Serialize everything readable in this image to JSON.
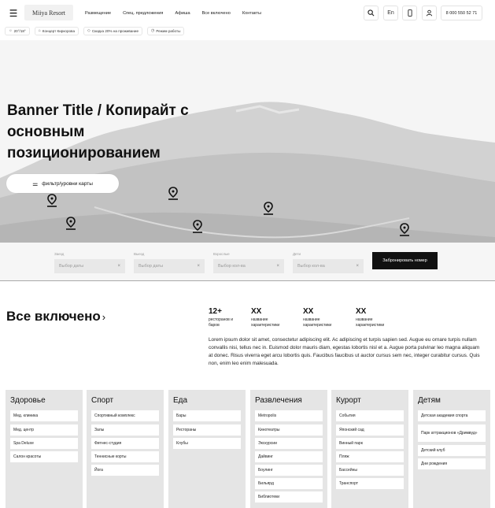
{
  "header": {
    "logo": "Miiya Resort",
    "nav": [
      "Размещение",
      "Спец. предложения",
      "Афиша",
      "Все включено",
      "Контакты"
    ],
    "lang": "En",
    "phone": "8 000 550 52 71"
  },
  "chips": [
    {
      "icon": "☼",
      "label": "20°/18°"
    },
    {
      "icon": "⌂",
      "label": "Концерт Киркорова"
    },
    {
      "icon": "◇",
      "label": "Скидка 20% на проживание"
    },
    {
      "icon": "◷",
      "label": "Режим работы"
    }
  ],
  "hero": {
    "title": "Banner Title / Копирайт с основным позиционированием",
    "filter_label": "фильтр/уровни карты"
  },
  "booking": {
    "fields": [
      {
        "label": "Заезд",
        "placeholder": "Выбор даты"
      },
      {
        "label": "Выезд",
        "placeholder": "Выбор даты"
      },
      {
        "label": "Взрослые",
        "placeholder": "Выбор кол-ва"
      },
      {
        "label": "Дети",
        "placeholder": "Выбор кол-ва"
      }
    ],
    "button": "Забронировать номер"
  },
  "all_inclusive": {
    "title": "Все включено",
    "stats": [
      {
        "value": "12+",
        "label": "ресторанов и баров"
      },
      {
        "value": "XX",
        "label": "название характеристики"
      },
      {
        "value": "XX",
        "label": "название характеристики"
      },
      {
        "value": "XX",
        "label": "название характеристики"
      }
    ],
    "description": "Lorem ipsum dolor sit amet, consectetur adipiscing elit. Ac adipiscing et turpis sapien sed. Augue eu ornare turpis nullam convallis nisi, tellus nec in. Euismod dolor mauris diam, egestas lobortis nisl et a. Augue porta pulvinar leo magna aliquam at donec. Risus viverra eget arcu lobortis quis. Faucibus faucibus ut auctor cursus sem nec, integer curabitur cursus. Quis non, enim leo enim malesuada."
  },
  "categories": [
    {
      "title": "Здоровье",
      "items": [
        "Мед. клиника",
        "Мед. центр",
        "Spa Deluxe",
        "Салон красоты"
      ]
    },
    {
      "title": "Спорт",
      "items": [
        "Спортивный комплекс",
        "Залы",
        "Фитнес-студия",
        "Теннисные корты",
        "Йога"
      ]
    },
    {
      "title": "Еда",
      "items": [
        "Бары",
        "Рестораны",
        "Клубы"
      ]
    },
    {
      "title": "Развлечения",
      "items": [
        "Metropolis",
        "Кинотеатры",
        "Экскурсии",
        "Дайвинг",
        "Боулинг",
        "Бильярд",
        "Библиотеки"
      ]
    },
    {
      "title": "Курорт",
      "items": [
        "События",
        "Японский сад",
        "Винный парк",
        "Пляж",
        "Бассейны",
        "Транспорт"
      ]
    },
    {
      "title": "Детям",
      "items": [
        "Детская академия спорта",
        "Парк аттракционов «Дримвуд»",
        "Детский клуб",
        "Дни рождения"
      ]
    }
  ]
}
